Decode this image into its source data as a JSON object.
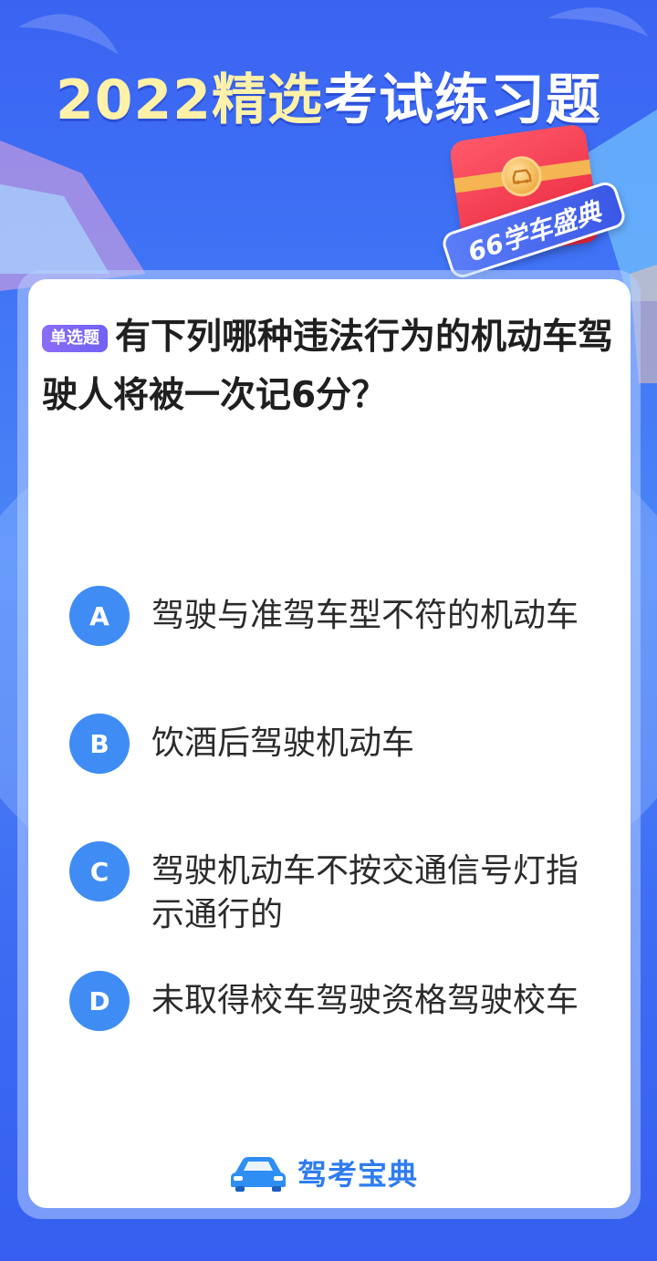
{
  "header": {
    "title_highlight": "2022精选",
    "title_rest": "考试练习题"
  },
  "badge": {
    "ribbon_text": "66学车盛典"
  },
  "question": {
    "type_tag": "单选题",
    "text": "有下列哪种违法行为的机动车驾驶人将被一次记6分？"
  },
  "options": [
    {
      "letter": "A",
      "text": "驾驶与准驾车型不符的机动车"
    },
    {
      "letter": "B",
      "text": "饮酒后驾驶机动车"
    },
    {
      "letter": "C",
      "text": "驾驶机动车不按交通信号灯指示通行的"
    },
    {
      "letter": "D",
      "text": "未取得校车驾驶资格驾驶校车"
    }
  ],
  "brand": {
    "name": "驾考宝典",
    "icon": "car-icon"
  },
  "colors": {
    "background": "#3f72f5",
    "option_circle": "#3f8cf5",
    "title_highlight": "#fff1a8",
    "tag": "#7b66f6",
    "brand": "#2f7cf0"
  }
}
